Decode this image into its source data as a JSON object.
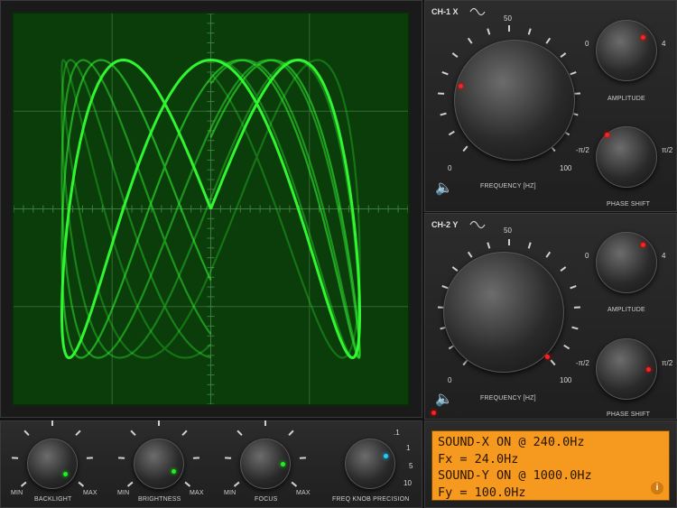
{
  "channel_x": {
    "title": "CH-1 X",
    "freq_scale": {
      "min": "0",
      "mid": "50",
      "max": "100"
    },
    "freq_label": "FREQUENCY [Hz]",
    "amp_scale": {
      "min": "0",
      "max": "4"
    },
    "amp_label": "AMPLITUDE",
    "phase_scale": {
      "min": "-π/2",
      "max": "π/2"
    },
    "phase_label": "PHASE SHIFT"
  },
  "channel_y": {
    "title": "CH-2 Y",
    "freq_scale": {
      "min": "0",
      "mid": "50",
      "max": "100"
    },
    "freq_label": "FREQUENCY [Hz]",
    "amp_scale": {
      "min": "0",
      "max": "4"
    },
    "amp_label": "AMPLITUDE",
    "phase_scale": {
      "min": "-π/2",
      "max": "π/2"
    },
    "phase_label": "PHASE SHIFT"
  },
  "bottom_knobs": [
    {
      "label": "BACKLIGHT",
      "min": "MIN",
      "max": "MAX"
    },
    {
      "label": "BRIGHTNESS",
      "min": "MIN",
      "max": "MAX"
    },
    {
      "label": "FOCUS",
      "min": "MIN",
      "max": "MAX"
    },
    {
      "label": "FREQ KNOB PRECISION",
      "ticks": [
        ".1",
        "1",
        "5",
        "10"
      ]
    }
  ],
  "lcd": {
    "line1": "SOUND-X ON @ 240.0Hz",
    "line2": "Fx = 24.0Hz",
    "line3": "SOUND-Y ON @ 1000.0Hz",
    "line4": "Fy = 100.0Hz",
    "info": "i"
  },
  "colors": {
    "trace": "#33ff33",
    "screen": "#0b3d0b",
    "lcd": "#f59a1e",
    "indicator_red": "#ff2020",
    "indicator_green": "#22ee22",
    "indicator_cyan": "#22ccff"
  }
}
